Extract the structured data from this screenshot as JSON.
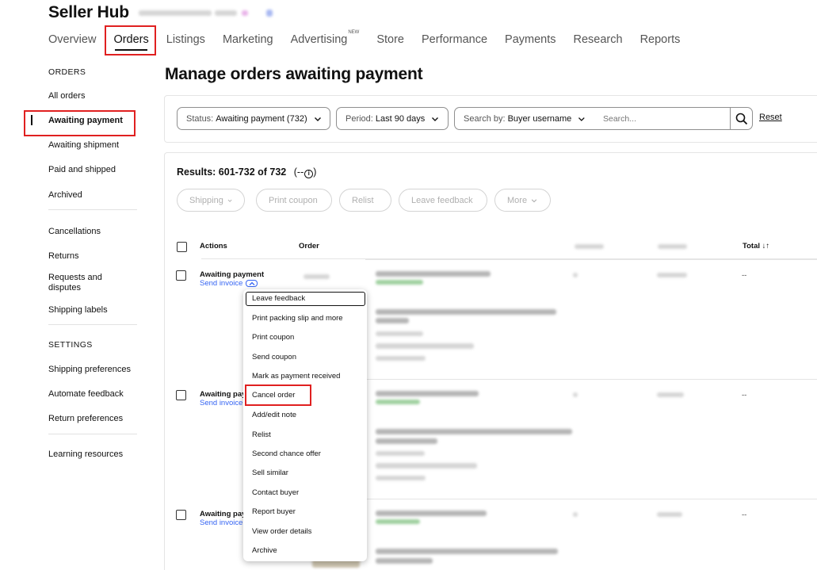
{
  "app": {
    "title": "Seller Hub"
  },
  "topnav": {
    "tabs": [
      {
        "label": "Overview",
        "active": false
      },
      {
        "label": "Orders",
        "active": true
      },
      {
        "label": "Listings",
        "active": false
      },
      {
        "label": "Marketing",
        "active": false
      },
      {
        "label": "Advertising",
        "badge": "NEW",
        "active": false
      },
      {
        "label": "Store",
        "active": false
      },
      {
        "label": "Performance",
        "active": false
      },
      {
        "label": "Payments",
        "active": false
      },
      {
        "label": "Research",
        "active": false
      },
      {
        "label": "Reports",
        "active": false
      }
    ]
  },
  "sidebar": {
    "orders_heading": "ORDERS",
    "orders_items": [
      {
        "label": "All orders",
        "active": false
      },
      {
        "label": "Awaiting payment",
        "active": true
      },
      {
        "label": "Awaiting shipment",
        "active": false
      },
      {
        "label": "Paid and shipped",
        "active": false
      },
      {
        "label": "Archived",
        "active": false
      }
    ],
    "other_items": [
      {
        "label": "Cancellations"
      },
      {
        "label": "Returns"
      },
      {
        "label": "Requests and disputes"
      },
      {
        "label": "Shipping labels"
      }
    ],
    "settings_heading": "SETTINGS",
    "settings_items": [
      {
        "label": "Shipping preferences"
      },
      {
        "label": "Automate feedback"
      },
      {
        "label": "Return preferences"
      }
    ],
    "resources_item": "Learning resources"
  },
  "main": {
    "page_title": "Manage orders awaiting payment",
    "filters": {
      "status": {
        "label": "Status:",
        "value": "Awaiting payment (732)"
      },
      "period": {
        "label": "Period:",
        "value": "Last 90 days"
      },
      "search_by": {
        "label": "Search by:",
        "value": "Buyer username"
      },
      "search_placeholder": "Search...",
      "reset_label": "Reset"
    },
    "results": {
      "text": "Results: 601-732 of 732",
      "info_prefix": "(--",
      "info_suffix": ")"
    },
    "bulk_actions": [
      {
        "label": "Shipping",
        "has_chevron": true
      },
      {
        "label": "Print coupon",
        "has_chevron": false
      },
      {
        "label": "Relist",
        "has_chevron": false
      },
      {
        "label": "Leave feedback",
        "has_chevron": false
      },
      {
        "label": "More",
        "has_chevron": true
      }
    ],
    "table": {
      "headers": {
        "actions": "Actions",
        "order": "Order",
        "total": "Total ↓↑"
      },
      "rows": [
        {
          "status": "Awaiting payment",
          "invoice_link": "Send invoice",
          "total": "--"
        },
        {
          "status": "Awaiting pay",
          "invoice_link": "Send invoice",
          "total": "--"
        },
        {
          "status": "Awaiting pay",
          "invoice_link": "Send invoice",
          "total": "--"
        }
      ]
    },
    "actions_menu": {
      "items": [
        "Leave feedback",
        "Print packing slip and more",
        "Print coupon",
        "Send coupon",
        "Mark as payment received",
        "Cancel order",
        "Add/edit note",
        "Relist",
        "Second chance offer",
        "Sell similar",
        "Contact buyer",
        "Report buyer",
        "View order details",
        "Archive"
      ],
      "focused_item": "Leave feedback",
      "highlighted_item": "Cancel order"
    }
  },
  "colors": {
    "link_blue": "#3665f3",
    "highlight_red": "#e02020",
    "text": "#191919"
  }
}
